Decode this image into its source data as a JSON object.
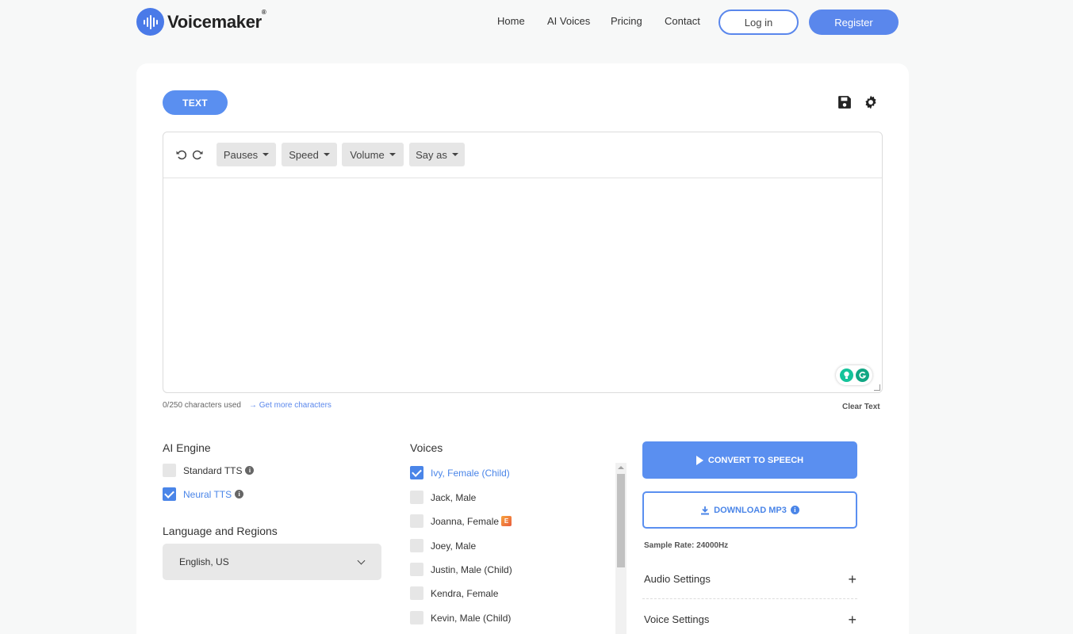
{
  "brand": {
    "name": "Voicemaker",
    "mark": "®",
    "color": "#4a7ae8"
  },
  "nav": {
    "links": [
      "Home",
      "AI Voices",
      "Pricing",
      "Contact"
    ],
    "login": "Log in",
    "register": "Register"
  },
  "editor": {
    "tab": "TEXT",
    "toolbar": {
      "pauses": "Pauses",
      "speed": "Speed",
      "volume": "Volume",
      "say_as": "Say as"
    },
    "text": "",
    "chars_used": "0/250 characters used",
    "get_more": "→ Get more characters",
    "clear": "Clear Text"
  },
  "engine": {
    "title": "AI Engine",
    "options": [
      {
        "label": "Standard TTS",
        "checked": false
      },
      {
        "label": "Neural TTS",
        "checked": true
      }
    ]
  },
  "language": {
    "title": "Language and Regions",
    "selected": "English, US"
  },
  "voices": {
    "title": "Voices",
    "items": [
      {
        "label": "Ivy, Female (Child)",
        "checked": true
      },
      {
        "label": "Jack, Male",
        "checked": false
      },
      {
        "label": "Joanna, Female",
        "checked": false,
        "badge": "E"
      },
      {
        "label": "Joey, Male",
        "checked": false
      },
      {
        "label": "Justin, Male (Child)",
        "checked": false
      },
      {
        "label": "Kendra, Female",
        "checked": false
      },
      {
        "label": "Kevin, Male (Child)",
        "checked": false
      }
    ]
  },
  "actions": {
    "convert": "CONVERT TO SPEECH",
    "download": "DOWNLOAD MP3",
    "sample_rate": "Sample Rate: 24000Hz",
    "audio_settings": "Audio Settings",
    "voice_settings": "Voice Settings",
    "accent_color": "#5a8ff0"
  }
}
